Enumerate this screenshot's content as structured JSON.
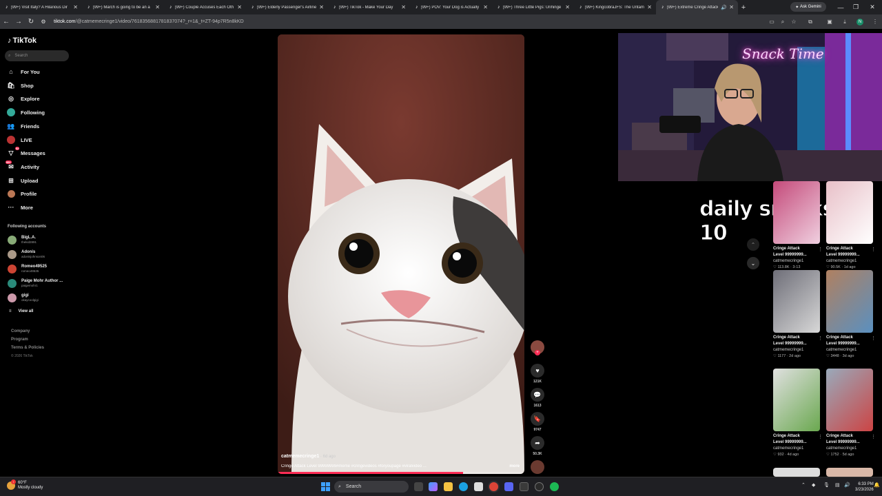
{
  "browser": {
    "tabs": [
      {
        "label": "(99+) Visit Italy? A Hilarious Dir"
      },
      {
        "label": "(99+) March is going to be an a"
      },
      {
        "label": "(99+) Couple Accuses Each Oth"
      },
      {
        "label": "(99+) Elderly Passenger's Airline"
      },
      {
        "label": "(99+) TikTok - Make Your Day"
      },
      {
        "label": "(99+) POV: Your Dog is Actually"
      },
      {
        "label": "(99+) Three Little Pigs: Unhinge"
      },
      {
        "label": "(99+) KingcobraJFS: The Untam"
      },
      {
        "label": "(99+) Extreme Cringe Attack"
      }
    ],
    "ask_gemini": "Ask Gemini",
    "url_domain": "tiktok.com",
    "url_path": "/@catmemecringe1/video/7618356881781837074?_r=1&_t=ZT-94p7R5n8kKD",
    "profile_initial": "N"
  },
  "sidebar": {
    "logo": "TikTok",
    "search_placeholder": "Search",
    "nav": [
      {
        "label": "For You",
        "icon": "home-icon"
      },
      {
        "label": "Shop",
        "icon": "shop-icon"
      },
      {
        "label": "Explore",
        "icon": "explore-icon"
      },
      {
        "label": "Following",
        "icon": "following-icon"
      },
      {
        "label": "Friends",
        "icon": "friends-icon"
      },
      {
        "label": "LIVE",
        "icon": "live-icon"
      },
      {
        "label": "Messages",
        "icon": "messages-icon",
        "badge": "52"
      },
      {
        "label": "Activity",
        "icon": "activity-icon",
        "badge": "99+"
      },
      {
        "label": "Upload",
        "icon": "upload-icon"
      },
      {
        "label": "Profile",
        "icon": "profile-icon"
      },
      {
        "label": "More",
        "icon": "more-icon"
      }
    ],
    "following_title": "Following accounts",
    "following": [
      {
        "name": "BigL.A.",
        "handle": "thekid2891"
      },
      {
        "name": "Adonis",
        "handle": "adonisjohnson06"
      },
      {
        "name": "Romeo49525",
        "handle": "romeo49535"
      },
      {
        "name": "Paige Mohr Author ...",
        "handle": "paigemohr1"
      },
      {
        "name": "gigi",
        "handle": "okaycoolgigi"
      }
    ],
    "view_all": "View all",
    "footer": [
      "Company",
      "Program",
      "Terms & Policies"
    ],
    "copyright": "© 2026 TikTok"
  },
  "video": {
    "author": "catmemecringe1",
    "age": " · 6d ago",
    "caption": "Cringe Attack Level 99999999#meme #cringevideos #foryoupage #viralvideo ...",
    "more": "more",
    "progress": 0.75,
    "likes": "121K",
    "comments": "1613",
    "saves": "9747",
    "shares": "50.3K"
  },
  "overlay": {
    "neon_sign": "Snack Time",
    "daily_snacks": "daily snacks  0 / 10"
  },
  "related": [
    {
      "title1": "Cringe Attack",
      "title2": "Level 99999999...",
      "user": "catmemecringe1",
      "meta": "♡ 113.8K · 3-13",
      "c1": "#c44a7a",
      "c2": "#f0d0e0"
    },
    {
      "title1": "Cringe Attack",
      "title2": "Level 99999999...",
      "user": "catmemecringe1",
      "meta": "♡ 90.5K · 1d ago",
      "c1": "#e8c0c8",
      "c2": "#ffffff"
    },
    {
      "title1": "Cringe Attack",
      "title2": "Level 99999999...",
      "user": "catmemecringe1",
      "meta": "♡ 1177 · 2d ago",
      "c1": "#6e6e78",
      "c2": "#d8d8d8"
    },
    {
      "title1": "Cringe Attack",
      "title2": "Level 99999999...",
      "user": "catmemecringe1",
      "meta": "♡ 3448 · 3d ago",
      "c1": "#b08060",
      "c2": "#5a90c0"
    },
    {
      "title1": "Cringe Attack",
      "title2": "Level 99999999...",
      "user": "catmemecringe1",
      "meta": "♡ 932 · 4d ago",
      "c1": "#e0e0e0",
      "c2": "#6aa84f"
    },
    {
      "title1": "Cringe Attack",
      "title2": "Level 99999999...",
      "user": "catmemecringe1",
      "meta": "♡ 1752 · 5d ago",
      "c1": "#9ab",
      "c2": "#c44"
    }
  ],
  "taskbar": {
    "weather_temp": "60°F",
    "weather_desc": "Mostly cloudy",
    "search": "Search",
    "time": "6:33 PM",
    "date": "3/23/2026"
  },
  "colors": {
    "accent": "#fe2c55",
    "bg": "#000000"
  }
}
